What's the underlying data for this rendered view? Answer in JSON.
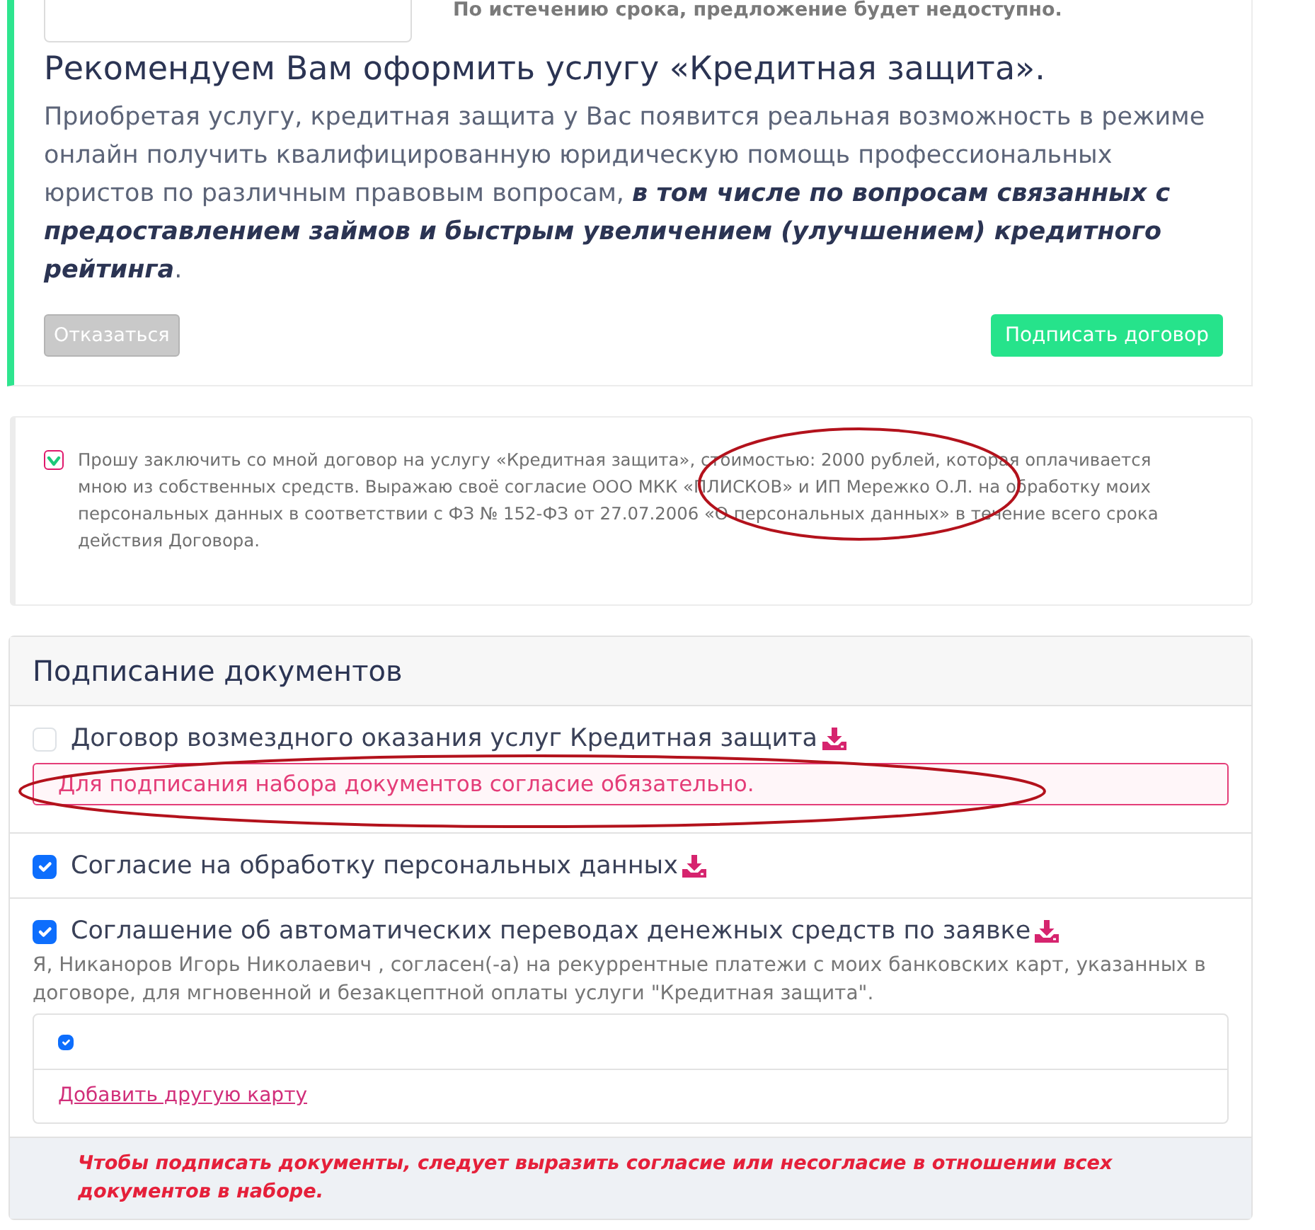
{
  "offer": {
    "expiry_note": "По истечению срока, предложение будет недоступно.",
    "title": "Рекомендуем Вам оформить услугу «Кредитная защита».",
    "text": "Приобретая услугу, кредитная защита у Вас появится реальная возможность в режиме онлайн получить квалифицированную юридическую помощь профессиональных юристов по различным правовым вопросам, **в том числе по вопросам связанных с предоставлением займов и быстрым увеличением (улучшением) кредитного рейтинга**.",
    "buttons": [
      {
        "label": "Отказаться",
        "kind": "decline"
      },
      {
        "label": "Подписать договор",
        "kind": "sign"
      }
    ]
  },
  "consent": {
    "checked": true,
    "circled": true,
    "text": "Прошу заключить со мной договор на услугу «Кредитная защита», стоимостью: 2000 рублей, которая оплачивается мною из собственных средств. Выражаю своё согласие ООО МКК «ПЛИСКОВ» и ИП Мережко О.Л. на обработку моих персональных данных в соответствии с ФЗ № 152-ФЗ от 27.07.2006 «О персональных данных» в течение всего срока действия Договора."
  },
  "documents": {
    "title": "Подписание документов",
    "items": [
      {
        "label": "Договор возмездного оказания услуг Кредитная защита",
        "checked": false,
        "error": "Для подписания набора документов согласие обязательно.",
        "error_circled": true
      },
      {
        "label": "Согласие на обработку персональных данных",
        "checked": true
      },
      {
        "label": "Соглашение об автоматических переводах денежных средств по заявке",
        "checked": true,
        "description": "Я, Никаноров Игорь Николаевич , согласен(-а) на рекуррентные платежи с моих банковских карт, указанных в договоре, для мгновенной и безакцептной оплаты услуги \"Кредитная защита\".",
        "cards": [
          {
            "checked": true
          }
        ],
        "add_card_link": "Добавить другую карту"
      }
    ],
    "footer_note": "Чтобы подписать документы, следует выразить согласие или несогласие в отношении всех документов в наборе."
  }
}
